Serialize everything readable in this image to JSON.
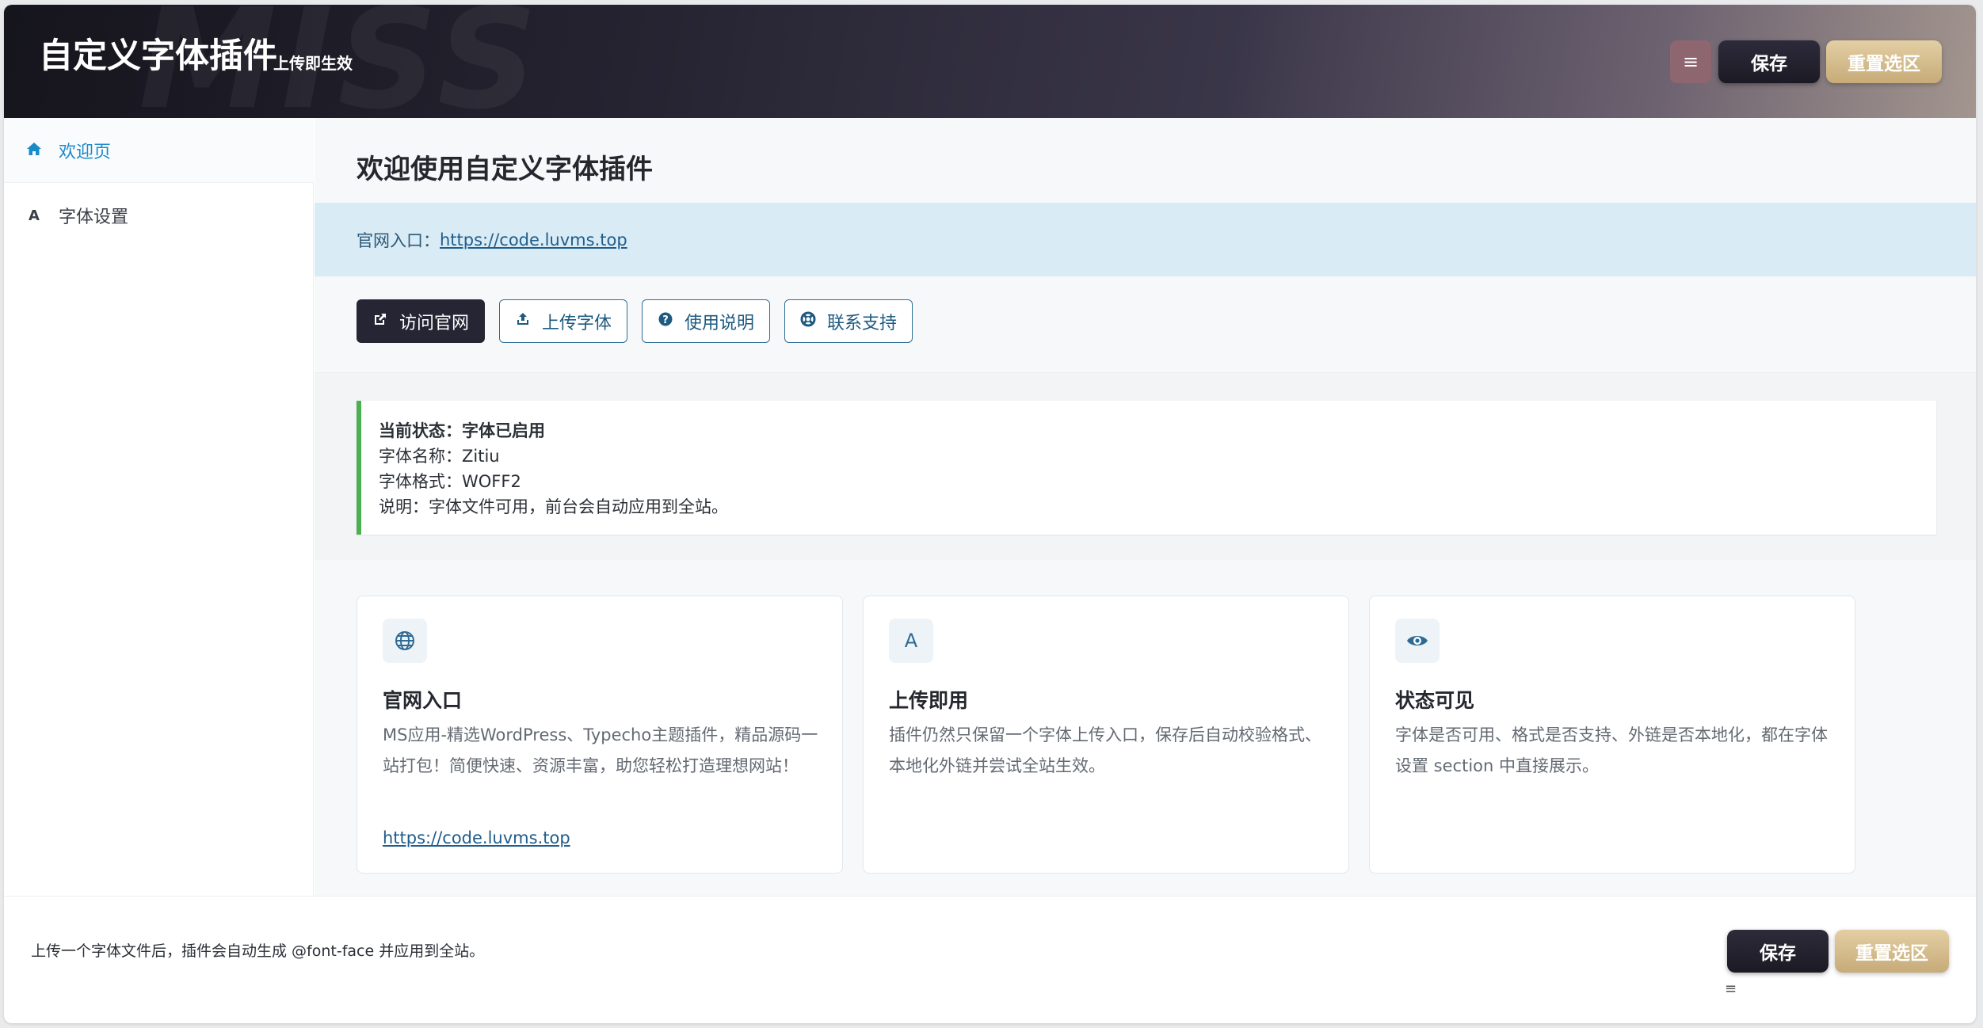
{
  "header": {
    "watermark": "MISS",
    "title": "自定义字体插件",
    "subtitle": "上传即生效",
    "menu_icon": "≡",
    "save_label": "保存",
    "reset_label": "重置选区"
  },
  "sidebar": {
    "items": [
      {
        "label": "欢迎页",
        "icon": "home-icon",
        "active": true
      },
      {
        "label": "字体设置",
        "icon": "font-icon",
        "active": false
      }
    ]
  },
  "main": {
    "title": "欢迎使用自定义字体插件",
    "info": {
      "prefix": "官网入口：",
      "link": "https://code.luvms.top"
    },
    "actions": [
      {
        "label": "访问官网",
        "icon": "external-link-icon"
      },
      {
        "label": "上传字体",
        "icon": "upload-icon"
      },
      {
        "label": "使用说明",
        "icon": "question-circle-icon"
      },
      {
        "label": "联系支持",
        "icon": "lifebuoy-icon"
      }
    ],
    "status": {
      "state_label": "当前状态：",
      "state_value": "字体已启用",
      "name_label": "字体名称：",
      "name_value": "Zitiu",
      "format_label": "字体格式：",
      "format_value": "WOFF2",
      "note_label": "说明：",
      "note_value": "字体文件可用，前台会自动应用到全站。",
      "accent_color": "#4caf50"
    },
    "cards": [
      {
        "icon": "globe-icon",
        "title": "官网入口",
        "text": "MS应用-精选WordPress、Typecho主题插件，精品源码一站打包！简便快速、资源丰富，助您轻松打造理想网站！",
        "link": "https://code.luvms.top"
      },
      {
        "icon": "font-icon",
        "title": "上传即用",
        "text": "插件仍然只保留一个字体上传入口，保存后自动校验格式、本地化外链并尝试全站生效。"
      },
      {
        "icon": "eye-icon",
        "title": "状态可见",
        "text": "字体是否可用、格式是否支持、外链是否本地化，都在字体设置 section 中直接展示。"
      }
    ]
  },
  "footer": {
    "note": "上传一个字体文件后，插件会自动生成 @font-face 并应用到全站。",
    "save_label": "保存",
    "reset_label": "重置选区",
    "menu_icon": "≡"
  },
  "colors": {
    "accent_blue": "#1a8bc9",
    "dark_button": "#262534",
    "gold_button": "#c7ab78",
    "info_bg": "#d9ebf4"
  }
}
